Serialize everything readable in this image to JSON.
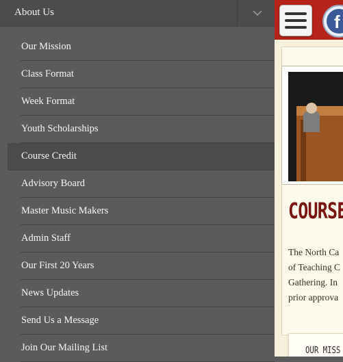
{
  "nav": {
    "section_title": "About Us",
    "items": [
      {
        "label": "Our Mission"
      },
      {
        "label": "Class Format"
      },
      {
        "label": "Week Format"
      },
      {
        "label": "Youth Scholarships"
      },
      {
        "label": "Course Credit",
        "active": true
      },
      {
        "label": "Advisory Board"
      },
      {
        "label": "Master Music Makers"
      },
      {
        "label": "Admin Staff"
      },
      {
        "label": "Our First 20 Years"
      },
      {
        "label": "News Updates"
      },
      {
        "label": "Send Us a Message"
      },
      {
        "label": "Join Our Mailing List"
      }
    ]
  },
  "page": {
    "facebook_letter": "f",
    "heading": "COURSE",
    "paragraph_lines": [
      "The North Ca",
      "of Teaching C",
      "Gathering. In",
      "prior approva"
    ],
    "mission_label": "OUR MISS"
  },
  "colors": {
    "topbar": "#b5231b",
    "heading": "#7a1410",
    "nav_bg": "#5b5b5b"
  }
}
